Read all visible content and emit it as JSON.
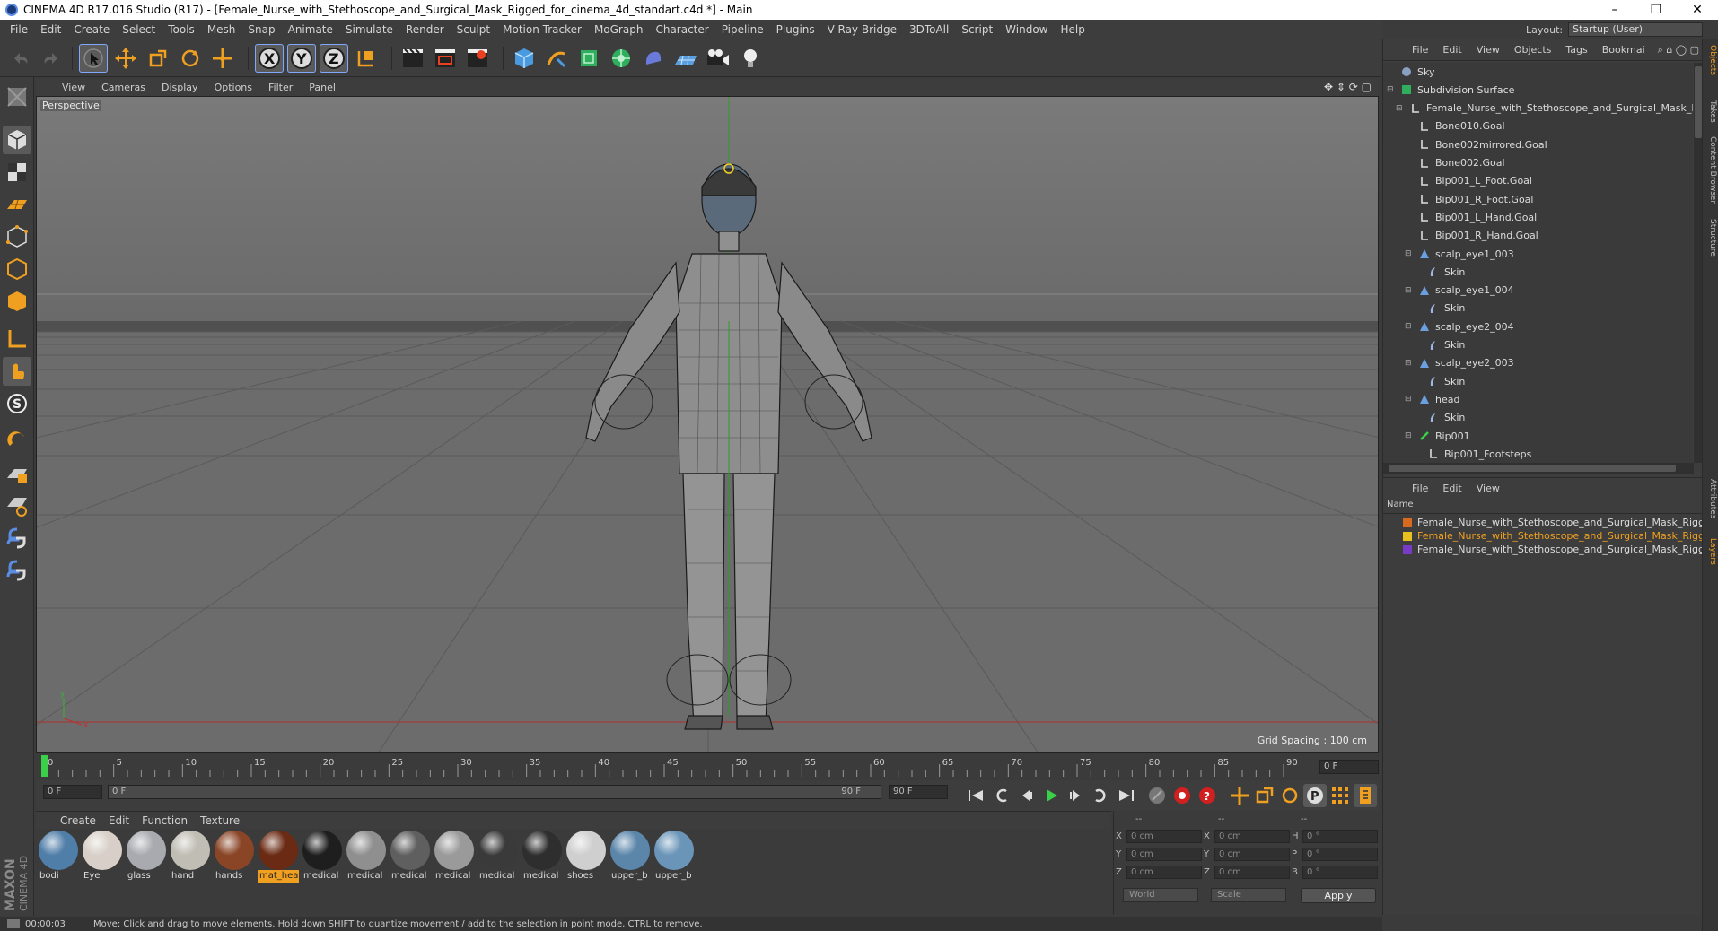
{
  "window": {
    "title": "CINEMA 4D R17.016 Studio (R17) - [Female_Nurse_with_Stethoscope_and_Surgical_Mask_Rigged_for_cinema_4d_standart.c4d *] - Main",
    "minimize": "–",
    "maximize": "❐",
    "close": "✕"
  },
  "menu": [
    "File",
    "Edit",
    "Create",
    "Select",
    "Tools",
    "Mesh",
    "Snap",
    "Animate",
    "Simulate",
    "Render",
    "Sculpt",
    "Motion Tracker",
    "MoGraph",
    "Character",
    "Pipeline",
    "Plugins",
    "V-Ray Bridge",
    "3DToAll",
    "Script",
    "Window",
    "Help"
  ],
  "layout": {
    "label": "Layout:",
    "value": "Startup (User)"
  },
  "viewport": {
    "menu": [
      "View",
      "Cameras",
      "Display",
      "Options",
      "Filter",
      "Panel"
    ],
    "label": "Perspective",
    "grid_spacing": "Grid Spacing : 100 cm"
  },
  "timeline": {
    "ticks": [
      "0",
      "5",
      "10",
      "15",
      "20",
      "25",
      "30",
      "35",
      "40",
      "45",
      "50",
      "55",
      "60",
      "65",
      "70",
      "75",
      "80",
      "85",
      "90"
    ],
    "current_frame": "0 F",
    "start_field": "0 F",
    "range_start": "0 F",
    "range_end": "90 F",
    "end_field": "90 F"
  },
  "materials": {
    "menu": [
      "Create",
      "Edit",
      "Function",
      "Texture"
    ],
    "items": [
      {
        "label": "bodi",
        "color": "#4f7ea8"
      },
      {
        "label": "Eye",
        "color": "#d8d0c8"
      },
      {
        "label": "glass",
        "color": "#a8aab0"
      },
      {
        "label": "hand",
        "color": "#c0bdb4"
      },
      {
        "label": "hands",
        "color": "#8a4526"
      },
      {
        "label": "mat_hea",
        "color": "#6a2a14"
      },
      {
        "label": "medical",
        "color": "#1e1e1e"
      },
      {
        "label": "medical",
        "color": "#8f8f8f"
      },
      {
        "label": "medical",
        "color": "#5f5f5f"
      },
      {
        "label": "medical",
        "color": "#9a9a9a"
      },
      {
        "label": "medical",
        "color": "#3a3a3a"
      },
      {
        "label": "medical",
        "color": "#2e2e2e"
      },
      {
        "label": "shoes",
        "color": "#cfcfcf"
      },
      {
        "label": "upper_b",
        "color": "#5b86aa"
      },
      {
        "label": "upper_b",
        "color": "#6a95b8"
      }
    ]
  },
  "coords": {
    "header": [
      "--",
      "--",
      "--"
    ],
    "rows": [
      {
        "a": "X",
        "av": "0 cm",
        "b": "X",
        "bv": "0 cm",
        "c": "H",
        "cv": "0 °"
      },
      {
        "a": "Y",
        "av": "0 cm",
        "b": "Y",
        "bv": "0 cm",
        "c": "P",
        "cv": "0 °"
      },
      {
        "a": "Z",
        "av": "0 cm",
        "b": "Z",
        "bv": "0 cm",
        "c": "B",
        "cv": "0 °"
      }
    ],
    "world": "World",
    "scale": "Scale",
    "apply": "Apply"
  },
  "status": {
    "time": "00:00:03",
    "message": "Move: Click and drag to move elements. Hold down SHIFT to quantize movement / add to the selection in point mode, CTRL to remove."
  },
  "objects": {
    "menu": [
      "File",
      "Edit",
      "View",
      "Objects",
      "Tags",
      "Bookmai"
    ],
    "rows": [
      {
        "label": "Sky",
        "indent": 0,
        "icon": "sky"
      },
      {
        "label": "Subdivision Surface",
        "indent": 0,
        "icon": "subdiv"
      },
      {
        "label": "Female_Nurse_with_Stethoscope_and_Surgical_Mask_Rigged",
        "indent": 1,
        "icon": "null"
      },
      {
        "label": "Bone010.Goal",
        "indent": 2,
        "icon": "null"
      },
      {
        "label": "Bone002mirrored.Goal",
        "indent": 2,
        "icon": "null"
      },
      {
        "label": "Bone002.Goal",
        "indent": 2,
        "icon": "null"
      },
      {
        "label": "Bip001_L_Foot.Goal",
        "indent": 2,
        "icon": "null"
      },
      {
        "label": "Bip001_R_Foot.Goal",
        "indent": 2,
        "icon": "null"
      },
      {
        "label": "Bip001_L_Hand.Goal",
        "indent": 2,
        "icon": "null"
      },
      {
        "label": "Bip001_R_Hand.Goal",
        "indent": 2,
        "icon": "null"
      },
      {
        "label": "scalp_eye1_003",
        "indent": 2,
        "icon": "poly"
      },
      {
        "label": "Skin",
        "indent": 3,
        "icon": "skin"
      },
      {
        "label": "scalp_eye1_004",
        "indent": 2,
        "icon": "poly"
      },
      {
        "label": "Skin",
        "indent": 3,
        "icon": "skin"
      },
      {
        "label": "scalp_eye2_004",
        "indent": 2,
        "icon": "poly"
      },
      {
        "label": "Skin",
        "indent": 3,
        "icon": "skin"
      },
      {
        "label": "scalp_eye2_003",
        "indent": 2,
        "icon": "poly"
      },
      {
        "label": "Skin",
        "indent": 3,
        "icon": "skin"
      },
      {
        "label": "head",
        "indent": 2,
        "icon": "poly"
      },
      {
        "label": "Skin",
        "indent": 3,
        "icon": "skin"
      },
      {
        "label": "Bip001",
        "indent": 2,
        "icon": "bone"
      },
      {
        "label": "Bip001_Footsteps",
        "indent": 3,
        "icon": "null"
      }
    ]
  },
  "layers": {
    "menu": [
      "File",
      "Edit",
      "View"
    ],
    "header": "Name",
    "rows": [
      {
        "label": "Female_Nurse_with_Stethoscope_and_Surgical_Mask_Rigged_",
        "color": "#d86a20",
        "selected": false
      },
      {
        "label": "Female_Nurse_with_Stethoscope_and_Surgical_Mask_Rigged_",
        "color": "#e8c020",
        "selected": true
      },
      {
        "label": "Female_Nurse_with_Stethoscope_and_Surgical_Mask_Rigged_",
        "color": "#7a3ac8",
        "selected": false
      }
    ]
  },
  "side_tabs": [
    "Objects",
    "Takes",
    "Content Browser",
    "Structure",
    "Attributes",
    "Layers"
  ]
}
